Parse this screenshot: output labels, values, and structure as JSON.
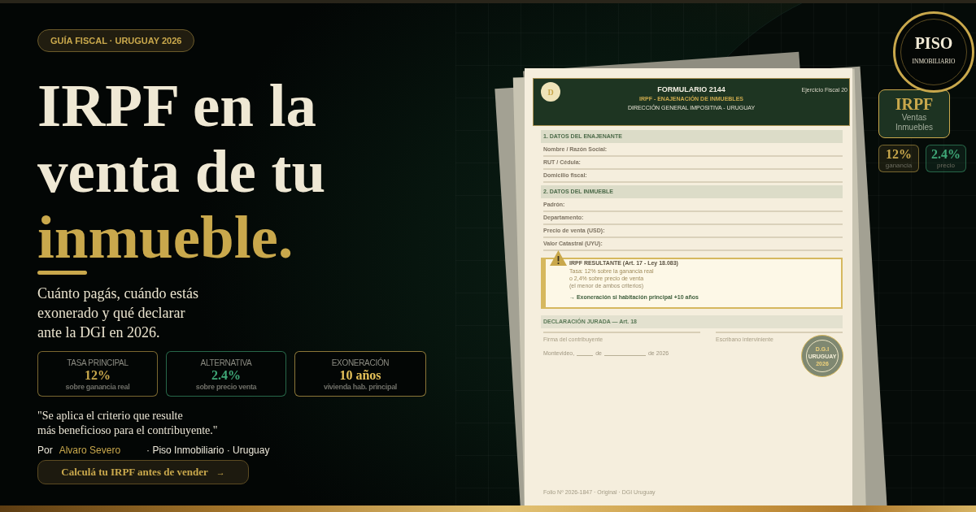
{
  "badge": "GUÍA FISCAL · URUGUAY 2026",
  "headline": {
    "lines": [
      "IRPF en la",
      "venta de tu"
    ],
    "highlight": "inmueble."
  },
  "intro": [
    "Cuánto pagás, cuándo estás",
    "exonerado y qué declarar",
    "ante la DGI en 2026."
  ],
  "stats": [
    {
      "label": "TASA PRINCIPAL",
      "value": "12%",
      "note": "sobre ganancia real",
      "color": "#c9a84c"
    },
    {
      "label": "ALTERNATIVA",
      "value": "2.4%",
      "note": "sobre precio venta",
      "color": "#3fa877"
    },
    {
      "label": "EXONERACIÓN",
      "value": "10 años",
      "note": "vivienda hab. principal",
      "color": "#e6c25a"
    }
  ],
  "quote": [
    "\"Se aplica el criterio que resulte",
    "más beneficioso para el contribuyente.\""
  ],
  "byline": {
    "prefix": "Por",
    "author": "Alvaro Severo",
    "suffix": "· Piso Inmobiliario · Uruguay"
  },
  "cta": {
    "label": "Calculá tu IRPF antes de vender",
    "arrow": "→"
  },
  "form": {
    "header": {
      "seal": "D",
      "title": "FORMULARIO 2144",
      "subtitle": "IRPF - ENAJENACIÓN DE INMUEBLES",
      "issuer": "DIRECCIÓN GENERAL IMPOSITIVA - URUGUAY",
      "fiscal_year": "Ejercicio Fiscal 20"
    },
    "sections": [
      {
        "title": "1. DATOS DEL ENAJENANTE",
        "fields": [
          "Nombre / Razón Social:",
          "RUT / Cédula:",
          "Domicilio fiscal:"
        ]
      },
      {
        "title": "2. DATOS DEL INMUEBLE",
        "fields": [
          "Padrón:",
          "Departamento:",
          "Precio de venta (USD):",
          "Valor Catastral (UYU):"
        ]
      }
    ],
    "result": {
      "title": "IRPF RESULTANTE (Art. 17 - Ley 18.083)",
      "lines": [
        "Tasa: 12% sobre la ganancia real",
        "o 2,4% sobre precio de venta"
      ],
      "note": "(el menor de ambos criterios)",
      "exemption": "→ Exoneración si habitación principal +10 años"
    },
    "declaration": {
      "title": "DECLARACIÓN JURADA — Art. 18",
      "signatures": [
        "Firma del contribuyente",
        "Escribano interviniente"
      ],
      "date_line": [
        {
          "kind": "text",
          "text": "Montevideo,"
        },
        {
          "kind": "blank"
        },
        {
          "kind": "text",
          "text": "de"
        },
        {
          "kind": "wideblank"
        },
        {
          "kind": "text",
          "text": "de 2026"
        }
      ]
    },
    "stamp": [
      "D.G.I",
      "URUGUAY",
      "2026"
    ],
    "footer": "Folio Nº 2026-1847 · Original · DGI Uruguay"
  },
  "brand_seal": {
    "name": "PISO",
    "tagline": "INMOBILIARIO"
  },
  "side_card": {
    "title": "IRPF",
    "lines": [
      "Ventas",
      "Inmuebles"
    ]
  },
  "side_stats": [
    {
      "value": "12%",
      "label": "ganancia",
      "color": "#c9a84c"
    },
    {
      "value": "2.4%",
      "label": "precio",
      "color": "#3fa877"
    }
  ]
}
